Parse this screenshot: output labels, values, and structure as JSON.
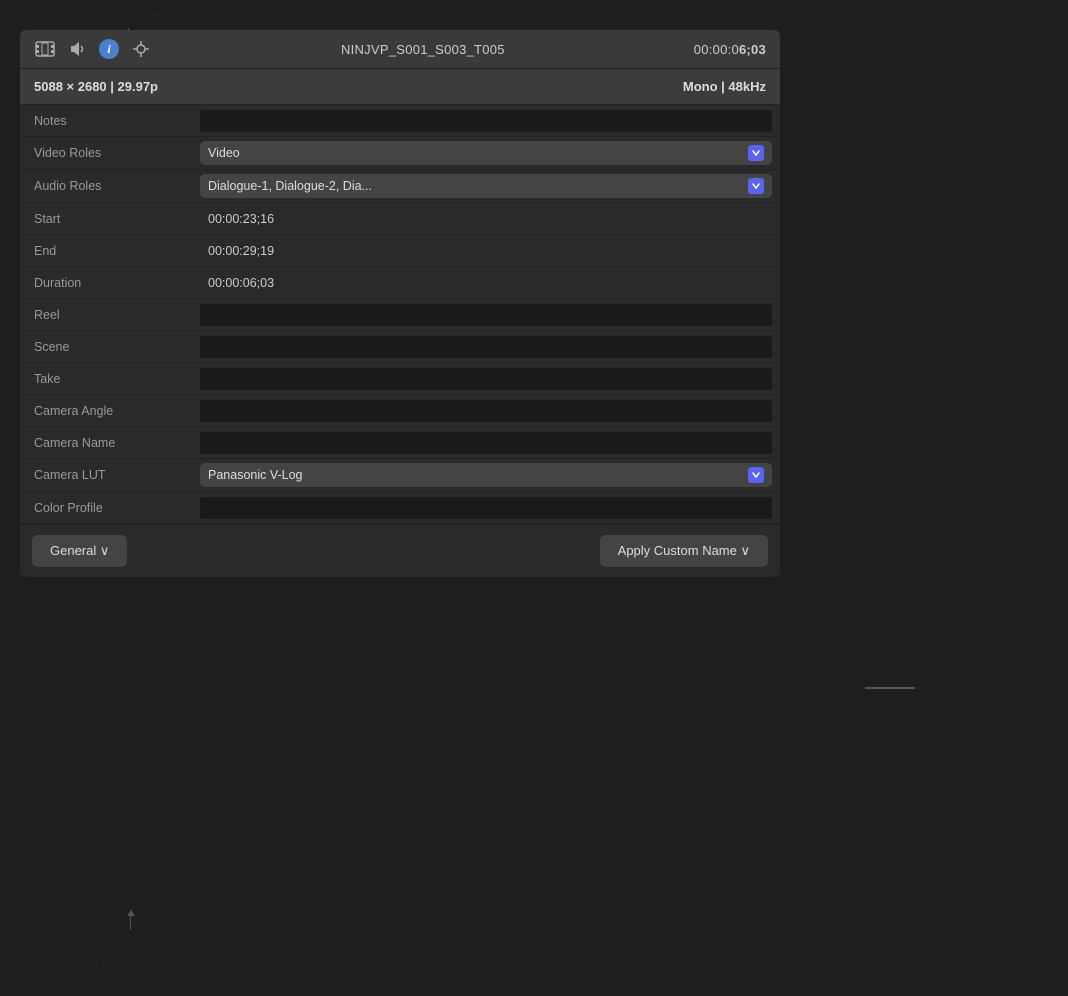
{
  "annotations": {
    "top_label": "Click the Info button.",
    "right_label": "Camera LUT setting",
    "bottom_label_line1": "Choose General,",
    "bottom_label_line2": "Extended, or Settings."
  },
  "toolbar": {
    "title": "NINJVP_S001_S003_T005",
    "timecode_pre": "00:00:0",
    "timecode_bold": "6;03",
    "icons": [
      "film-icon",
      "audio-icon",
      "info-icon",
      "transform-icon"
    ]
  },
  "info_bar": {
    "left": "5088 × 2680 | 29.97p",
    "right": "Mono | 48kHz"
  },
  "fields": [
    {
      "label": "Notes",
      "type": "input",
      "value": ""
    },
    {
      "label": "Video Roles",
      "type": "dropdown",
      "value": "Video"
    },
    {
      "label": "Audio Roles",
      "type": "dropdown",
      "value": "Dialogue-1, Dialogue-2, Dia..."
    },
    {
      "label": "Start",
      "type": "text",
      "value": "00:00:23;16"
    },
    {
      "label": "End",
      "type": "text",
      "value": "00:00:29;19"
    },
    {
      "label": "Duration",
      "type": "text",
      "value": "00:00:06;03"
    },
    {
      "label": "Reel",
      "type": "input",
      "value": ""
    },
    {
      "label": "Scene",
      "type": "input",
      "value": ""
    },
    {
      "label": "Take",
      "type": "input",
      "value": ""
    },
    {
      "label": "Camera Angle",
      "type": "input",
      "value": ""
    },
    {
      "label": "Camera Name",
      "type": "input",
      "value": ""
    },
    {
      "label": "Camera LUT",
      "type": "dropdown",
      "value": "Panasonic V-Log"
    },
    {
      "label": "Color Profile",
      "type": "input",
      "value": ""
    }
  ],
  "bottom_bar": {
    "left_btn": "General ∨",
    "right_btn": "Apply Custom Name ∨"
  }
}
